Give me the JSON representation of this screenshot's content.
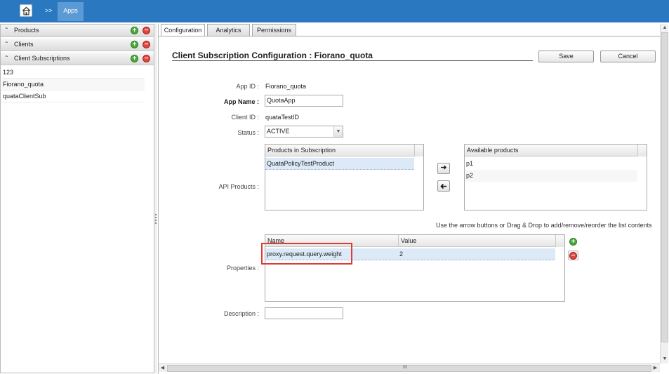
{
  "topbar": {
    "home_icon": "home-icon",
    "separator": ">>",
    "apps_label": "Apps"
  },
  "sidebar": {
    "sections": [
      {
        "label": "Products",
        "icon": "chevron-up-icon"
      },
      {
        "label": "Clients",
        "icon": "chevron-up-icon"
      },
      {
        "label": "Client Subscriptions",
        "icon": "chevron-up-icon"
      }
    ],
    "subscriptions": [
      "123",
      "Fiorano_quota",
      "quataClientSub"
    ],
    "add_symbol": "+",
    "remove_symbol": "−"
  },
  "tabs": [
    {
      "label": "Configuration",
      "active": true
    },
    {
      "label": "Analytics",
      "active": false
    },
    {
      "label": "Permissions",
      "active": false
    }
  ],
  "page": {
    "title": "Client Subscription Configuration : Fiorano_quota",
    "save_label": "Save",
    "cancel_label": "Cancel"
  },
  "form": {
    "app_id_label": "App ID :",
    "app_id_value": "Fiorano_quota",
    "app_name_label": "App Name :",
    "app_name_value": "QuotaApp",
    "client_id_label": "Client ID :",
    "client_id_value": "quataTestID",
    "status_label": "Status :",
    "status_value": "ACTIVE",
    "api_products_label": "API Products :",
    "properties_label": "Properties :",
    "description_label": "Description :",
    "description_value": ""
  },
  "products": {
    "subscribed_header": "Products in Subscription",
    "subscribed": [
      "QuataPolicyTestProduct"
    ],
    "available_header": "Available products",
    "available": [
      "p1",
      "p2"
    ],
    "move_right": "➜",
    "move_left": "🡐",
    "hint": "Use the arrow buttons or Drag & Drop to add/remove/reorder the list contents"
  },
  "properties": {
    "headers": [
      "Name",
      "Value"
    ],
    "rows": [
      {
        "name": "proxy.request.query.weight",
        "value": "2"
      }
    ]
  },
  "scrollbars": {
    "h_grip": "III"
  },
  "colors": {
    "topbar": "#2a78c0",
    "apps_tab": "#5b9ad4",
    "highlight": "#e03a33",
    "add": "#4aa83a",
    "remove": "#e0453f"
  }
}
